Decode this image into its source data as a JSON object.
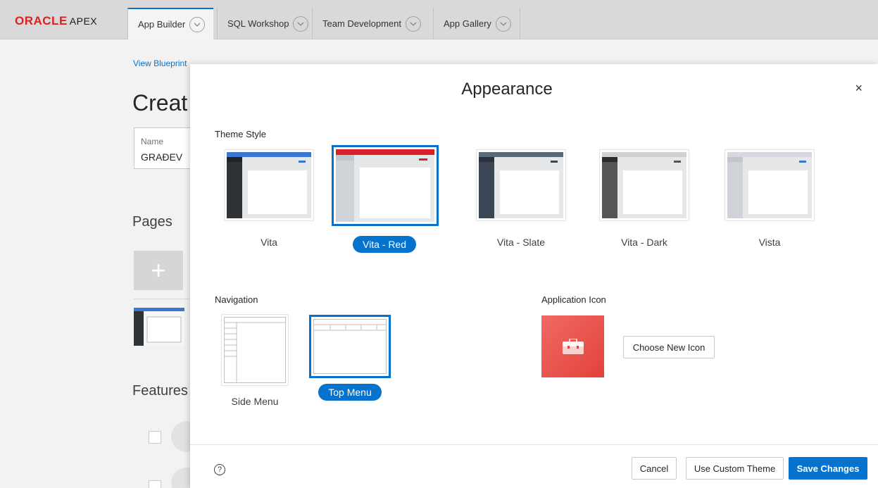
{
  "brand": {
    "oracle": "ORACLE",
    "apex": "APEX"
  },
  "tabs": [
    {
      "label": "App Builder"
    },
    {
      "label": "SQL Workshop"
    },
    {
      "label": "Team Development"
    },
    {
      "label": "App Gallery"
    }
  ],
  "background": {
    "link": "View Blueprint",
    "title": "Creat",
    "name_label": "Name",
    "name_value": "GRAĐEV",
    "pages_heading": "Pages",
    "features_heading": "Features"
  },
  "modal": {
    "title": "Appearance",
    "close": "×",
    "theme_style_label": "Theme Style",
    "themes": [
      {
        "name": "Vita",
        "header_color": "#3a77d1",
        "sidebar_color": "#2f3338",
        "selected": false
      },
      {
        "name": "Vita - Red",
        "header_color": "#d9202a",
        "sidebar_color": "#cfd3d7",
        "selected": true
      },
      {
        "name": "Vita - Slate",
        "header_color": "#5a6978",
        "sidebar_color": "#3a4653",
        "selected": false
      },
      {
        "name": "Vita - Dark",
        "header_color": "#d0d0d0",
        "sidebar_color": "#555555",
        "selected": false
      },
      {
        "name": "Vista",
        "header_color": "#d5d8dc",
        "sidebar_color": "#cfd3d7",
        "selected": false
      }
    ],
    "navigation_label": "Navigation",
    "navigation": [
      {
        "name": "Side Menu",
        "selected": false
      },
      {
        "name": "Top Menu",
        "selected": true
      }
    ],
    "app_icon_label": "Application Icon",
    "choose_icon": "Choose New Icon",
    "help": "?",
    "cancel": "Cancel",
    "custom_theme": "Use Custom Theme",
    "save": "Save Changes",
    "colors": {
      "accent": "#0572ce",
      "icon_bg": "#e84c45"
    }
  }
}
